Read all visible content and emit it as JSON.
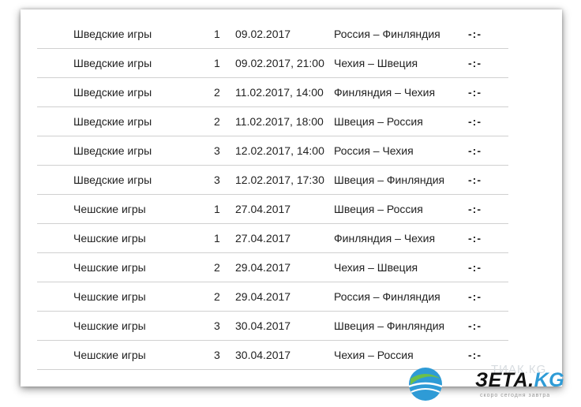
{
  "schedule": {
    "rows": [
      {
        "tournament": "Шведские игры",
        "round": "1",
        "datetime": "09.02.2017",
        "match": "Россия – Финляндия",
        "score": "-:-"
      },
      {
        "tournament": "Шведские игры",
        "round": "1",
        "datetime": "09.02.2017, 21:00",
        "match": "Чехия – Швеция",
        "score": "-:-"
      },
      {
        "tournament": "Шведские игры",
        "round": "2",
        "datetime": "11.02.2017, 14:00",
        "match": "Финляндия – Чехия",
        "score": "-:-"
      },
      {
        "tournament": "Шведские игры",
        "round": "2",
        "datetime": "11.02.2017, 18:00",
        "match": "Швеция – Россия",
        "score": "-:-"
      },
      {
        "tournament": "Шведские игры",
        "round": "3",
        "datetime": "12.02.2017, 14:00",
        "match": "Россия – Чехия",
        "score": "-:-"
      },
      {
        "tournament": "Шведские игры",
        "round": "3",
        "datetime": "12.02.2017, 17:30",
        "match": "Швеция – Финляндия",
        "score": "-:-"
      },
      {
        "tournament": "Чешские игры",
        "round": "1",
        "datetime": "27.04.2017",
        "match": "Швеция – Россия",
        "score": "-:-"
      },
      {
        "tournament": "Чешские игры",
        "round": "1",
        "datetime": "27.04.2017",
        "match": "Финляндия – Чехия",
        "score": "-:-"
      },
      {
        "tournament": "Чешские игры",
        "round": "2",
        "datetime": "29.04.2017",
        "match": "Чехия – Швеция",
        "score": "-:-"
      },
      {
        "tournament": "Чешские игры",
        "round": "2",
        "datetime": "29.04.2017",
        "match": "Россия – Финляндия",
        "score": "-:-"
      },
      {
        "tournament": "Чешские игры",
        "round": "3",
        "datetime": "30.04.2017",
        "match": "Швеция – Финляндия",
        "score": "-:-"
      },
      {
        "tournament": "Чешские игры",
        "round": "3",
        "datetime": "30.04.2017",
        "match": "Чехия – Россия",
        "score": "-:-"
      }
    ]
  },
  "watermark": {
    "logo_text_main": "ЗЕТА.",
    "logo_text_accent": "KG",
    "ghost_text": "ТИАК.КG",
    "tagline": "скоро сегодня завтра",
    "icon": "globe-icon",
    "colors": {
      "globe_blue": "#2e9bd6",
      "globe_green": "#6cc04a",
      "text": "#111111"
    }
  }
}
